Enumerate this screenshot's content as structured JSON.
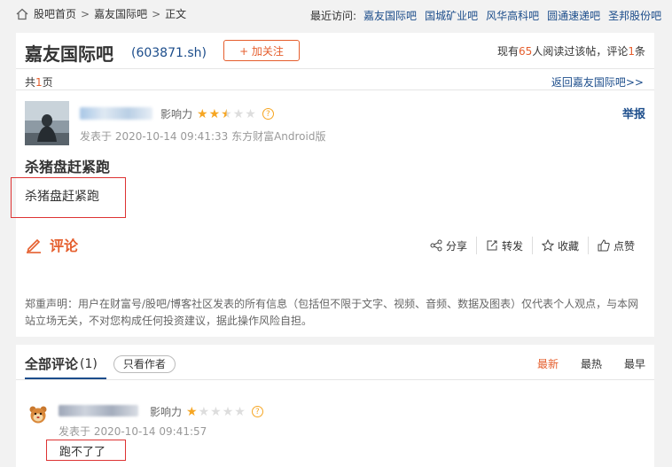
{
  "breadcrumb": {
    "items": [
      "股吧首页",
      "嘉友国际吧",
      "正文"
    ]
  },
  "recent": {
    "label": "最近访问:",
    "links": [
      "嘉友国际吧",
      "国城矿业吧",
      "风华高科吧",
      "圆通速递吧",
      "圣邦股份吧"
    ]
  },
  "bar": {
    "name": "嘉友国际吧",
    "code": "(603871.sh)",
    "follow_label": "+ 加关注",
    "stats_prefix": "现有",
    "stats_readers": "65",
    "stats_mid": "人阅读过该帖，评论",
    "stats_comments": "1",
    "stats_suffix": "条"
  },
  "paging": {
    "prefix": "共",
    "pages": "1",
    "suffix": "页",
    "back_link": "返回嘉友国际吧>>"
  },
  "post": {
    "influence_label": "影响力",
    "influence_stars": 2.5,
    "report_label": "举报",
    "time": "发表于 2020-10-14 09:41:33 东方财富Android版",
    "title": "杀猪盘赶紧跑",
    "body": "杀猪盘赶紧跑"
  },
  "actions": {
    "comment_label": "评论",
    "share": "分享",
    "repost": "转发",
    "collect": "收藏",
    "like": "点赞"
  },
  "disclaimer": "郑重声明：用户在财富号/股吧/博客社区发表的所有信息（包括但不限于文字、视频、音频、数据及图表）仅代表个人观点，与本网站立场无关，不对您构成任何投资建议，据此操作风险自担。",
  "comments": {
    "title": "全部评论",
    "count": "(1)",
    "author_only": "只看作者",
    "sorts": [
      "最新",
      "最热",
      "最早"
    ],
    "items": [
      {
        "influence_label": "影响力",
        "influence_stars": 1,
        "time": "发表于 2020-10-14 09:41:57",
        "text": "跑不了了"
      }
    ]
  },
  "colors": {
    "accent": "#e55e2d",
    "link": "#1c4d8b",
    "star": "#f6a623"
  }
}
